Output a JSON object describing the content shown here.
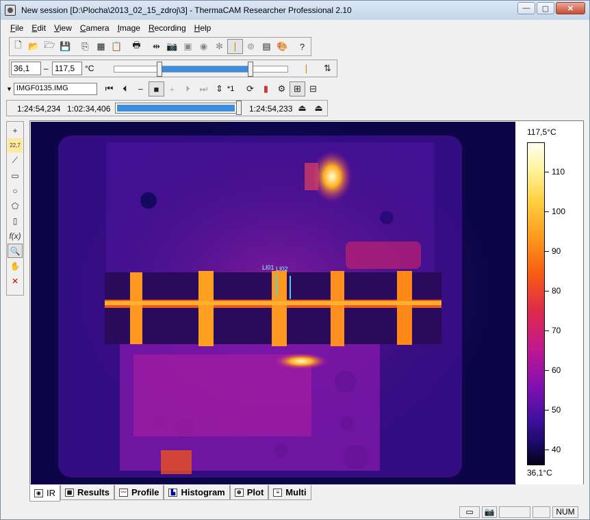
{
  "window": {
    "title": "New session [D:\\Plocha\\2013_02_15_zdroj\\3] - ThermaCAM Researcher Professional 2.10"
  },
  "window_buttons": {
    "minimize": "—",
    "maximize": "▢",
    "close": "✕"
  },
  "menu": [
    {
      "label": "File",
      "accel": "F",
      "rest": "ile"
    },
    {
      "label": "Edit",
      "accel": "E",
      "rest": "dit"
    },
    {
      "label": "View",
      "accel": "V",
      "rest": "iew"
    },
    {
      "label": "Camera",
      "accel": "C",
      "rest": "amera"
    },
    {
      "label": "Image",
      "accel": "I",
      "rest": "mage"
    },
    {
      "label": "Recording",
      "accel": "R",
      "rest": "ecording"
    },
    {
      "label": "Help",
      "accel": "H",
      "rest": "elp"
    }
  ],
  "toolbar1": [
    "new-icon",
    "open-icon",
    "open-image-icon",
    "save-icon",
    "copy-icon",
    "copy-image-icon",
    "paste-icon",
    "print-icon",
    "fit-icon",
    "camera-icon",
    "snapshot-icon",
    "color-icon",
    "fan-icon",
    "autoadjust-icon",
    "focus-icon",
    "settings-icon",
    "palette-icon",
    "help-icon"
  ],
  "range": {
    "low": "36,1",
    "dash": "–",
    "high": "117,5",
    "unit": "°C"
  },
  "range_slider": {
    "low_fraction": 0.27,
    "high_fraction": 0.77
  },
  "file": {
    "name": "IMGF0135.IMG",
    "step": "*1"
  },
  "recording": {
    "start": "1:24:54,234",
    "current": "1:02:34,406",
    "end": "1:24:54,233",
    "progress": 1.0
  },
  "scale": {
    "max_label": "117,5°C",
    "min_label": "36,1°C",
    "ticks": [
      "110",
      "100",
      "90",
      "80",
      "70",
      "60",
      "50",
      "40"
    ],
    "min_value": 36.1,
    "max_value": 117.5
  },
  "overlay": {
    "line1": "LI01",
    "line2": "LI02"
  },
  "tabs": [
    {
      "label": "IR",
      "icon": "ir-tab-icon"
    },
    {
      "label": "Results",
      "icon": "results-tab-icon"
    },
    {
      "label": "Profile",
      "icon": "profile-tab-icon"
    },
    {
      "label": "Histogram",
      "icon": "histogram-tab-icon"
    },
    {
      "label": "Plot",
      "icon": "plot-tab-icon"
    },
    {
      "label": "Multi",
      "icon": "multi-tab-icon"
    }
  ],
  "status": {
    "num": "NUM"
  }
}
